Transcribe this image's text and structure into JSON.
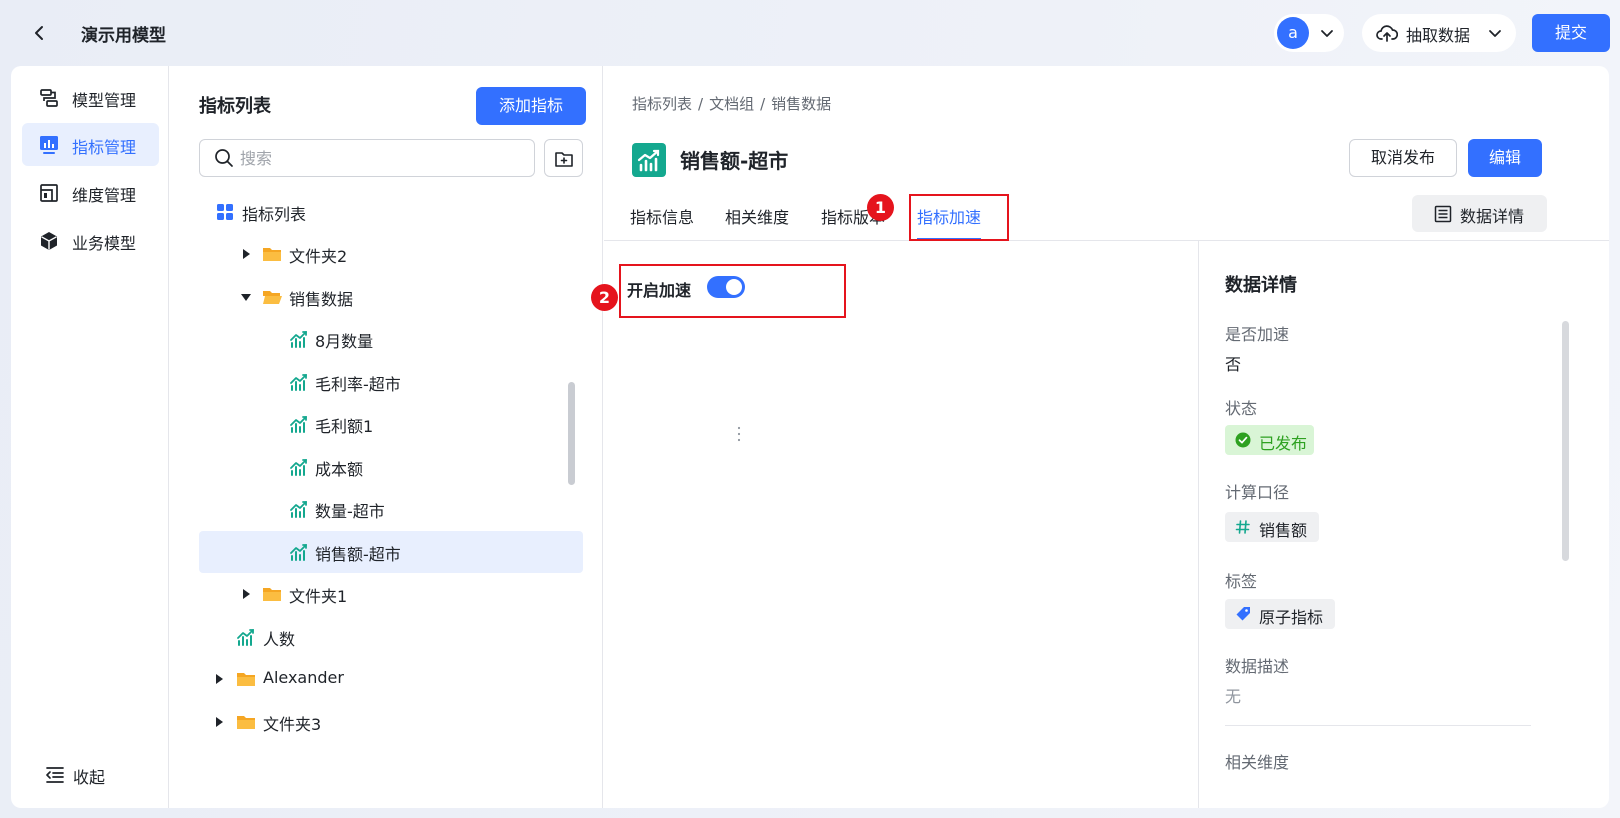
{
  "topbar": {
    "title": "演示用模型",
    "avatar_letter": "a",
    "extract_label": "抽取数据",
    "submit_label": "提交"
  },
  "nav": {
    "items": [
      {
        "label": "模型管理",
        "icon": "model-icon"
      },
      {
        "label": "指标管理",
        "icon": "metric-icon",
        "active": true
      },
      {
        "label": "维度管理",
        "icon": "dimension-icon"
      },
      {
        "label": "业务模型",
        "icon": "cube-icon"
      }
    ],
    "collapse_label": "收起"
  },
  "tree": {
    "title": "指标列表",
    "add_label": "添加指标",
    "search_placeholder": "搜索",
    "rows": [
      {
        "label": "指标列表",
        "type": "root"
      },
      {
        "label": "文件夹2",
        "type": "folder",
        "expanded": false
      },
      {
        "label": "销售数据",
        "type": "folder",
        "expanded": true
      },
      {
        "label": "8月数量",
        "type": "metric"
      },
      {
        "label": "毛利率-超市",
        "type": "metric"
      },
      {
        "label": "毛利额1",
        "type": "metric"
      },
      {
        "label": "成本额",
        "type": "metric"
      },
      {
        "label": "数量-超市",
        "type": "metric"
      },
      {
        "label": "销售额-超市",
        "type": "metric",
        "selected": true
      },
      {
        "label": "文件夹1",
        "type": "folder",
        "expanded": false
      },
      {
        "label": "人数",
        "type": "metric"
      },
      {
        "label": "Alexander",
        "type": "folder",
        "expanded": false
      },
      {
        "label": "文件夹3",
        "type": "folder",
        "expanded": false
      }
    ]
  },
  "detail": {
    "breadcrumb": [
      "指标列表",
      "文档组",
      "销售数据"
    ],
    "breadcrumb_sep": "/",
    "title": "销售额-超市",
    "unpublish_label": "取消发布",
    "edit_label": "编辑",
    "tabs": [
      "指标信息",
      "相关维度",
      "指标版本",
      "指标加速"
    ],
    "active_tab": "指标加速",
    "data_detail_label": "数据详情",
    "accel_label": "开启加速",
    "accel_enabled": true,
    "annotations": [
      "1",
      "2"
    ]
  },
  "sidepanel": {
    "title": "数据详情",
    "accel_label": "是否加速",
    "accel_value": "否",
    "status_label": "状态",
    "status_value": "已发布",
    "calc_label": "计算口径",
    "calc_value": "销售额",
    "tag_label": "标签",
    "tag_value": "原子指标",
    "desc_label": "数据描述",
    "desc_value": "无",
    "related_label": "相关维度"
  },
  "colors": {
    "primary": "#3370ff",
    "success": "#2ea121",
    "annotation": "#e5141d",
    "folder": "#f5a623",
    "metric": "#14a88f"
  }
}
